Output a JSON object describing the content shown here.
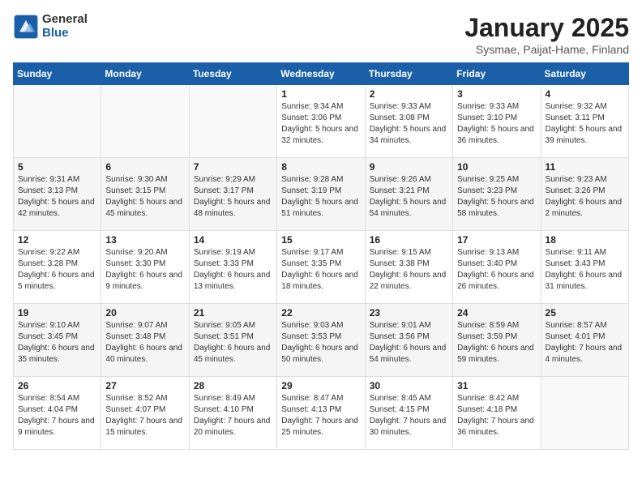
{
  "logo": {
    "general": "General",
    "blue": "Blue"
  },
  "title": "January 2025",
  "subtitle": "Sysmae, Paijat-Hame, Finland",
  "weekdays": [
    "Sunday",
    "Monday",
    "Tuesday",
    "Wednesday",
    "Thursday",
    "Friday",
    "Saturday"
  ],
  "weeks": [
    [
      {
        "day": "",
        "info": ""
      },
      {
        "day": "",
        "info": ""
      },
      {
        "day": "",
        "info": ""
      },
      {
        "day": "1",
        "info": "Sunrise: 9:34 AM\nSunset: 3:06 PM\nDaylight: 5 hours and 32 minutes."
      },
      {
        "day": "2",
        "info": "Sunrise: 9:33 AM\nSunset: 3:08 PM\nDaylight: 5 hours and 34 minutes."
      },
      {
        "day": "3",
        "info": "Sunrise: 9:33 AM\nSunset: 3:10 PM\nDaylight: 5 hours and 36 minutes."
      },
      {
        "day": "4",
        "info": "Sunrise: 9:32 AM\nSunset: 3:11 PM\nDaylight: 5 hours and 39 minutes."
      }
    ],
    [
      {
        "day": "5",
        "info": "Sunrise: 9:31 AM\nSunset: 3:13 PM\nDaylight: 5 hours and 42 minutes."
      },
      {
        "day": "6",
        "info": "Sunrise: 9:30 AM\nSunset: 3:15 PM\nDaylight: 5 hours and 45 minutes."
      },
      {
        "day": "7",
        "info": "Sunrise: 9:29 AM\nSunset: 3:17 PM\nDaylight: 5 hours and 48 minutes."
      },
      {
        "day": "8",
        "info": "Sunrise: 9:28 AM\nSunset: 3:19 PM\nDaylight: 5 hours and 51 minutes."
      },
      {
        "day": "9",
        "info": "Sunrise: 9:26 AM\nSunset: 3:21 PM\nDaylight: 5 hours and 54 minutes."
      },
      {
        "day": "10",
        "info": "Sunrise: 9:25 AM\nSunset: 3:23 PM\nDaylight: 5 hours and 58 minutes."
      },
      {
        "day": "11",
        "info": "Sunrise: 9:23 AM\nSunset: 3:26 PM\nDaylight: 6 hours and 2 minutes."
      }
    ],
    [
      {
        "day": "12",
        "info": "Sunrise: 9:22 AM\nSunset: 3:28 PM\nDaylight: 6 hours and 5 minutes."
      },
      {
        "day": "13",
        "info": "Sunrise: 9:20 AM\nSunset: 3:30 PM\nDaylight: 6 hours and 9 minutes."
      },
      {
        "day": "14",
        "info": "Sunrise: 9:19 AM\nSunset: 3:33 PM\nDaylight: 6 hours and 13 minutes."
      },
      {
        "day": "15",
        "info": "Sunrise: 9:17 AM\nSunset: 3:35 PM\nDaylight: 6 hours and 18 minutes."
      },
      {
        "day": "16",
        "info": "Sunrise: 9:15 AM\nSunset: 3:38 PM\nDaylight: 6 hours and 22 minutes."
      },
      {
        "day": "17",
        "info": "Sunrise: 9:13 AM\nSunset: 3:40 PM\nDaylight: 6 hours and 26 minutes."
      },
      {
        "day": "18",
        "info": "Sunrise: 9:11 AM\nSunset: 3:43 PM\nDaylight: 6 hours and 31 minutes."
      }
    ],
    [
      {
        "day": "19",
        "info": "Sunrise: 9:10 AM\nSunset: 3:45 PM\nDaylight: 6 hours and 35 minutes."
      },
      {
        "day": "20",
        "info": "Sunrise: 9:07 AM\nSunset: 3:48 PM\nDaylight: 6 hours and 40 minutes."
      },
      {
        "day": "21",
        "info": "Sunrise: 9:05 AM\nSunset: 3:51 PM\nDaylight: 6 hours and 45 minutes."
      },
      {
        "day": "22",
        "info": "Sunrise: 9:03 AM\nSunset: 3:53 PM\nDaylight: 6 hours and 50 minutes."
      },
      {
        "day": "23",
        "info": "Sunrise: 9:01 AM\nSunset: 3:56 PM\nDaylight: 6 hours and 54 minutes."
      },
      {
        "day": "24",
        "info": "Sunrise: 8:59 AM\nSunset: 3:59 PM\nDaylight: 6 hours and 59 minutes."
      },
      {
        "day": "25",
        "info": "Sunrise: 8:57 AM\nSunset: 4:01 PM\nDaylight: 7 hours and 4 minutes."
      }
    ],
    [
      {
        "day": "26",
        "info": "Sunrise: 8:54 AM\nSunset: 4:04 PM\nDaylight: 7 hours and 9 minutes."
      },
      {
        "day": "27",
        "info": "Sunrise: 8:52 AM\nSunset: 4:07 PM\nDaylight: 7 hours and 15 minutes."
      },
      {
        "day": "28",
        "info": "Sunrise: 8:49 AM\nSunset: 4:10 PM\nDaylight: 7 hours and 20 minutes."
      },
      {
        "day": "29",
        "info": "Sunrise: 8:47 AM\nSunset: 4:13 PM\nDaylight: 7 hours and 25 minutes."
      },
      {
        "day": "30",
        "info": "Sunrise: 8:45 AM\nSunset: 4:15 PM\nDaylight: 7 hours and 30 minutes."
      },
      {
        "day": "31",
        "info": "Sunrise: 8:42 AM\nSunset: 4:18 PM\nDaylight: 7 hours and 36 minutes."
      },
      {
        "day": "",
        "info": ""
      }
    ]
  ]
}
